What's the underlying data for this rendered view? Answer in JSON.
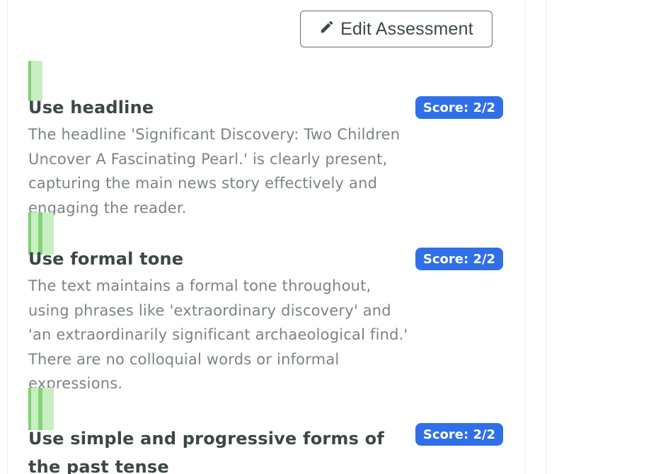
{
  "toolbar": {
    "edit_label": "Edit Assessment"
  },
  "criteria": [
    {
      "title": "Use headline",
      "score": "Score: 2/2",
      "description": "The headline 'Significant Discovery: Two Children Uncover A Fascinating Pearl.' is clearly present, capturing the main news story effectively and engaging the reader."
    },
    {
      "title": "Use formal tone",
      "score": "Score: 2/2",
      "description": "The text maintains a formal tone throughout, using phrases like 'extraordinary discovery' and 'an extraordinarily significant archaeological find.' There are no colloquial words or informal expressions."
    },
    {
      "title": "Use simple and progressive forms of the past tense",
      "score": "Score: 2/2",
      "description": ""
    }
  ],
  "colors": {
    "accent": "#2f6fe8",
    "highlight": "#c8efc1",
    "title": "#3d4747",
    "body": "#7b8484"
  }
}
